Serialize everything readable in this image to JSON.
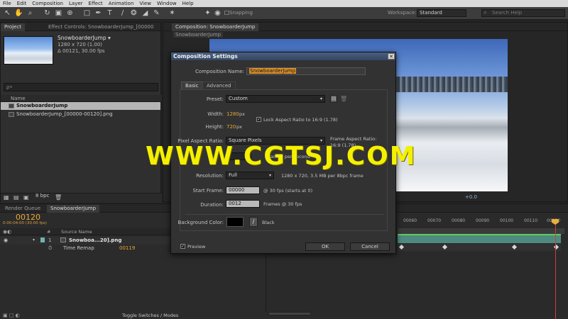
{
  "menu": [
    "File",
    "Edit",
    "Composition",
    "Layer",
    "Effect",
    "Animation",
    "View",
    "Window",
    "Help"
  ],
  "toolbar": {
    "snapping_label": "Snapping",
    "workspace_label": "Workspace:",
    "workspace_value": "Standard",
    "search_placeholder": "Search Help"
  },
  "project_panel": {
    "tabs": [
      "Project",
      "Effect Controls: SnowboarderJump_[00000"
    ],
    "item_name": "SnowboarderJump ▾",
    "item_size": "1280 x 720 (1.00)",
    "item_duration": "Δ 00121, 30.00 fps",
    "search_placeholder": "ρ•",
    "column_header": "Name",
    "rows": [
      "SnowboarderJump",
      "SnowboarderJump_[00000-00120].png"
    ],
    "bpc": "8 bpc"
  },
  "comp_panel": {
    "tab": "Composition: SnowboarderJump",
    "subtab": "SnowboarderJump",
    "offset_readout": "+0.0"
  },
  "timeline": {
    "tabs": [
      "Render Queue",
      "SnowboarderJump"
    ],
    "current_time": "00120",
    "time_sub": "0:00:04:00 (30.00 fps)",
    "source_header": "Source Name",
    "layer_number": "1",
    "layer_name": "Snowboa...20].png",
    "time_remap_label": "Time Remap",
    "time_remap_value": "00119",
    "ruler_ticks": [
      "00060",
      "00070",
      "00080",
      "00090",
      "00100",
      "00110",
      "00120"
    ],
    "toggle_label": "Toggle Switches / Modes"
  },
  "dialog": {
    "title": "Composition Settings",
    "close": "✕",
    "name_label": "Composition Name:",
    "name_value": "SnowboarderJump",
    "tabs": [
      "Basic",
      "Advanced"
    ],
    "preset_label": "Preset:",
    "preset_value": "Custom",
    "width_label": "Width:",
    "width_value": "1280",
    "height_label": "Height:",
    "height_value": "720",
    "unit_px": "px",
    "lock_aspect": "Lock Aspect Ratio to 16:9 (1.78)",
    "par_label": "Pixel Aspect Ratio:",
    "par_value": "Square Pixels",
    "frame_aspect_label": "Frame Aspect Ratio:",
    "frame_aspect_value": "16:9 (1.78)",
    "frame_rate_suffix": "frames per second",
    "resolution_label": "Resolution:",
    "resolution_value": "Full",
    "resolution_info": "1280 x 720, 3.5 MB per 8bpc frame",
    "start_label": "Start Frame:",
    "start_value": "00000",
    "start_info": "@ 30 fps (starts at 0)",
    "duration_label": "Duration:",
    "duration_value": "0012",
    "duration_info": "Frames @ 30 fps",
    "bg_label": "Background Color:",
    "bg_name": "Black",
    "bg_color": "#000000",
    "preview_label": "Preview",
    "ok_label": "OK",
    "cancel_label": "Cancel"
  },
  "watermark": "WWW.CGTSJ.COM",
  "colors": {
    "accent_orange": "#e8a83a",
    "playhead": "#c94040",
    "work_area": "#4f8a80",
    "watermark": "#f5f000"
  }
}
